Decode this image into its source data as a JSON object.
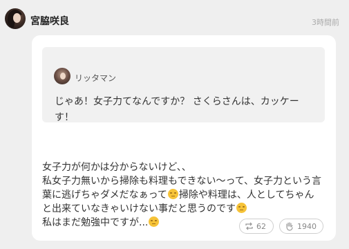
{
  "post": {
    "author": "宮脇咲良",
    "time": "3時間前"
  },
  "quoted": {
    "author": "リッタマン",
    "text_lines": [
      "じゃあ！女子力てなんですか？ さくらさんは、カッケー",
      "す！"
    ]
  },
  "body": {
    "line1": "女子力が何かは分からないけど、、",
    "line2": "私女子力無いから掃除も料理もできない〜って、女子力という言",
    "line3a": "葉に逃げちゃダメだなぁって",
    "line3b": "掃除や料理は、人としてちゃん",
    "line4": "と出来ていなきゃいけない事だと思うのです",
    "line5": "私はまだ勉強中ですが...",
    "emoji_icon": "sweat-smile-emoji"
  },
  "actions": {
    "repost_count": "62",
    "like_count": "1940"
  }
}
